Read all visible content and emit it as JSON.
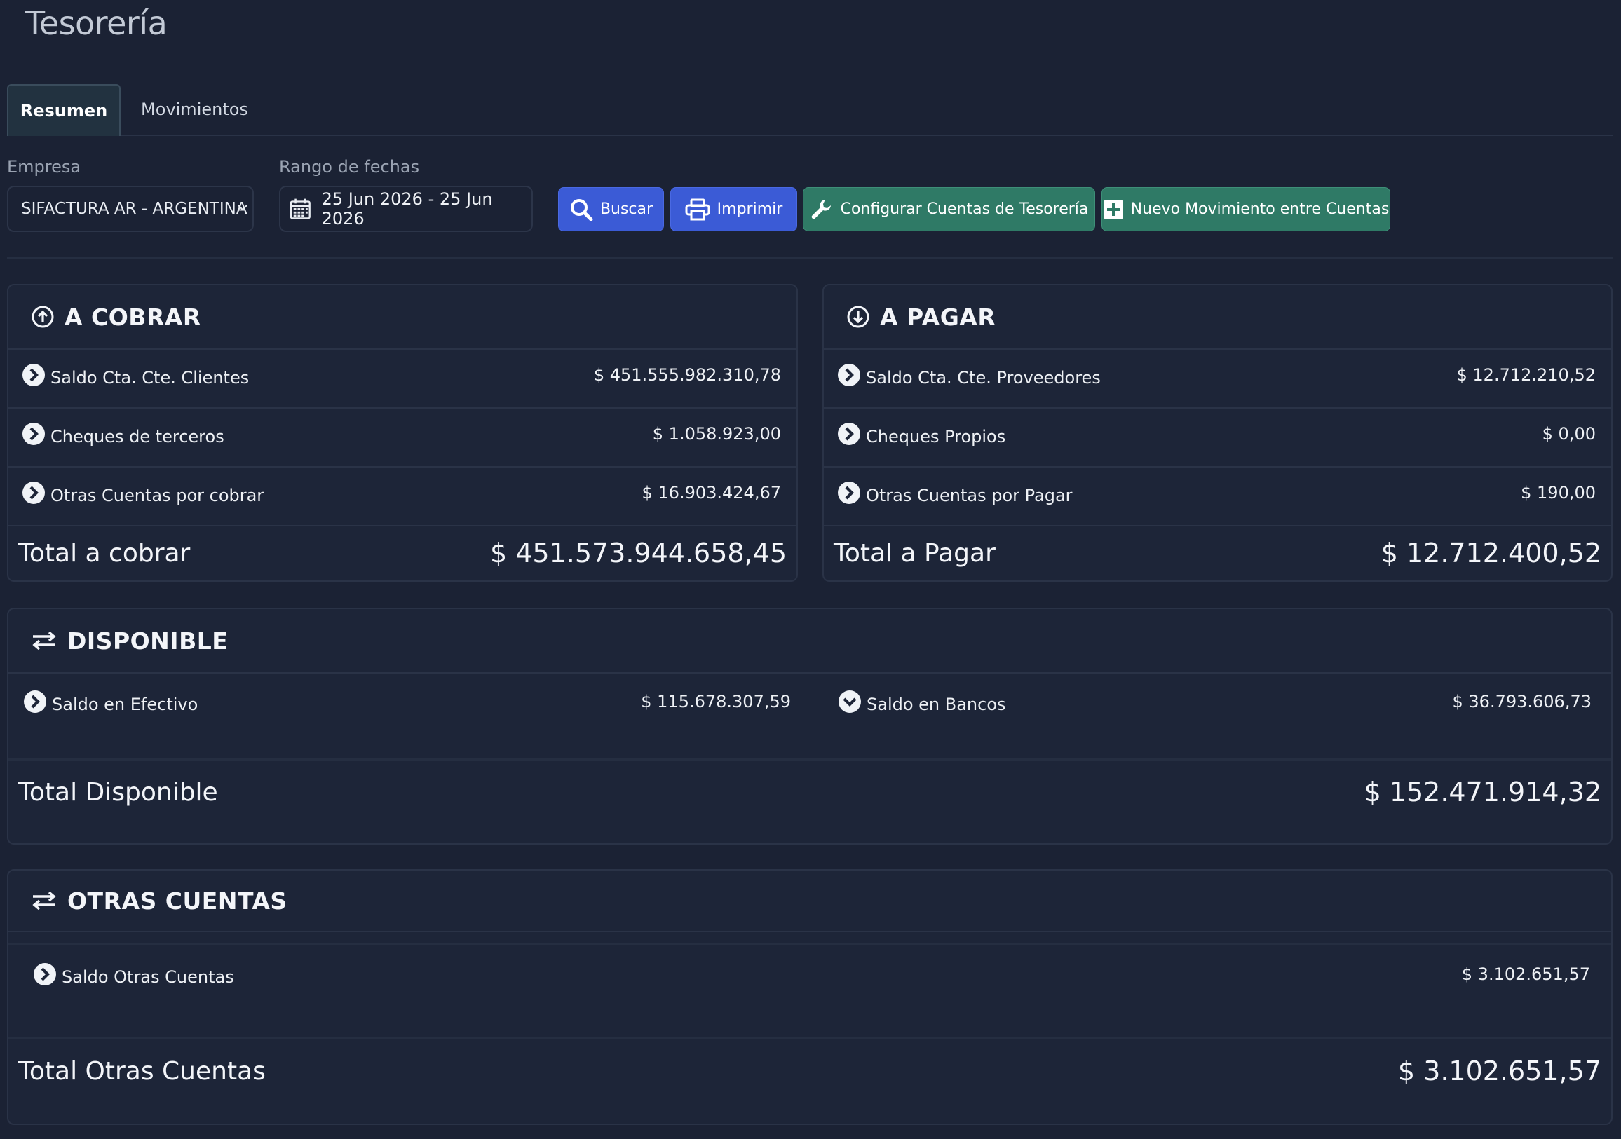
{
  "page": {
    "title": "Tesorería"
  },
  "tabs": [
    {
      "label": "Resumen",
      "active": true
    },
    {
      "label": "Movimientos",
      "active": false
    }
  ],
  "filters": {
    "empresa_label": "Empresa",
    "empresa_value": "SIFACTURA AR - ARGENTINA",
    "rango_label": "Rango de fechas",
    "rango_value": "25 Jun 2026 - 25 Jun 2026"
  },
  "buttons": {
    "buscar": "Buscar",
    "imprimir": "Imprimir",
    "configurar": "Configurar Cuentas de Tesorería",
    "nuevo": "Nuevo Movimiento entre Cuentas"
  },
  "a_cobrar": {
    "title": "A COBRAR",
    "rows": [
      {
        "label": "Saldo Cta. Cte. Clientes",
        "value": "$ 451.555.982.310,78"
      },
      {
        "label": "Cheques de terceros",
        "value": "$ 1.058.923,00"
      },
      {
        "label": "Otras Cuentas por cobrar",
        "value": "$ 16.903.424,67"
      }
    ],
    "total_label": "Total a cobrar",
    "total_value": "$ 451.573.944.658,45"
  },
  "a_pagar": {
    "title": "A PAGAR",
    "rows": [
      {
        "label": "Saldo Cta. Cte. Proveedores",
        "value": "$ 12.712.210,52"
      },
      {
        "label": "Cheques Propios",
        "value": "$ 0,00"
      },
      {
        "label": "Otras Cuentas por Pagar",
        "value": "$ 190,00"
      }
    ],
    "total_label": "Total a Pagar",
    "total_value": "$ 12.712.400,52"
  },
  "disponible": {
    "title": "DISPONIBLE",
    "efectivo_label": "Saldo en Efectivo",
    "efectivo_value": "$ 115.678.307,59",
    "bancos_label": "Saldo en Bancos",
    "bancos_value": "$ 36.793.606,73",
    "total_label": "Total Disponible",
    "total_value": "$ 152.471.914,32"
  },
  "otras_cuentas": {
    "title": "OTRAS CUENTAS",
    "saldo_label": "Saldo Otras Cuentas",
    "saldo_value": "$ 3.102.651,57",
    "total_label": "Total Otras Cuentas",
    "total_value": "$ 3.102.651,57"
  },
  "colors": {
    "background": "#1b2234",
    "card": "#1d2538",
    "primary_button": "#3b5bd6",
    "success_button": "#2f7a66"
  },
  "icons": {
    "row": "chevron-right-circle-icon",
    "expanded": "chevron-down-circle-icon",
    "cobrar": "arrow-up-circle-icon",
    "pagar": "arrow-down-circle-icon",
    "exchange": "exchange-icon"
  }
}
